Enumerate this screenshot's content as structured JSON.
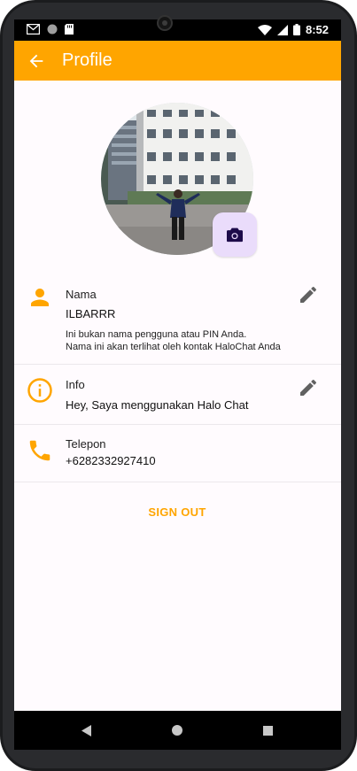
{
  "status_bar": {
    "time": "8:52",
    "left_icons": [
      "gmail-icon",
      "circle-icon",
      "sd-card-icon"
    ],
    "right_icons": [
      "wifi-icon",
      "signal-icon",
      "battery-icon"
    ]
  },
  "app_bar": {
    "title": "Profile",
    "back_icon": "arrow-back-icon",
    "color": "#ffa500"
  },
  "avatar": {
    "camera_icon": "camera-icon"
  },
  "profile": {
    "name": {
      "label": "Nama",
      "value": "ILBARRR",
      "note_line1": "Ini bukan nama pengguna atau PIN Anda.",
      "note_line2": "Nama ini akan terlihat oleh kontak HaloChat Anda"
    },
    "info": {
      "label": "Info",
      "value": "Hey, Saya menggunakan Halo Chat"
    },
    "phone": {
      "label": "Telepon",
      "value": "+6282332927410"
    }
  },
  "actions": {
    "sign_out": "SIGN OUT"
  },
  "colors": {
    "accent": "#ffa500",
    "background": "#fffbfe",
    "camera_button_bg": "#eadcfb"
  }
}
